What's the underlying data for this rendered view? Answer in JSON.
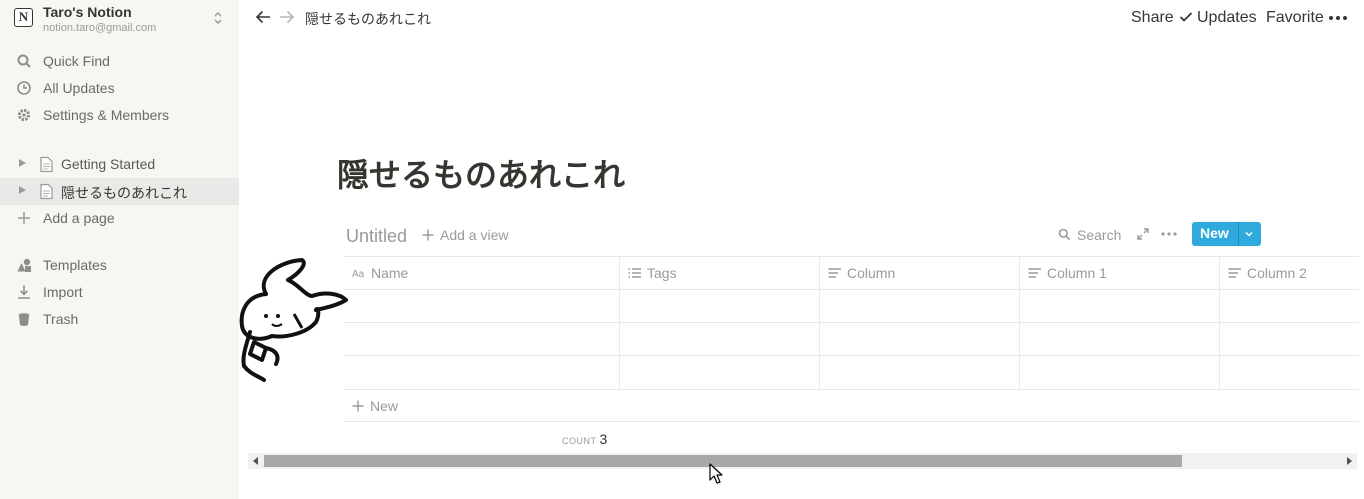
{
  "workspace": {
    "name": "Taro's Notion",
    "email": "notion.taro@gmail.com",
    "logo_letter": "N"
  },
  "sidebar": {
    "top_items": [
      {
        "label": "Quick Find",
        "icon": "search-icon"
      },
      {
        "label": "All Updates",
        "icon": "clock-icon"
      },
      {
        "label": "Settings & Members",
        "icon": "gear-icon"
      }
    ],
    "pages": [
      {
        "label": "Getting Started",
        "icon": "page-icon",
        "active": false
      },
      {
        "label": "隠せるものあれこれ",
        "icon": "page-icon",
        "active": true
      }
    ],
    "add_page": "Add a page",
    "bottom_items": [
      {
        "label": "Templates",
        "icon": "shapes-icon"
      },
      {
        "label": "Import",
        "icon": "download-icon"
      },
      {
        "label": "Trash",
        "icon": "trash-icon"
      }
    ]
  },
  "topbar": {
    "breadcrumb": "隠せるものあれこれ",
    "share": "Share",
    "updates": "Updates",
    "favorite": "Favorite"
  },
  "page": {
    "title": "隠せるものあれこれ"
  },
  "database": {
    "title": "Untitled",
    "add_view": "Add a view",
    "search": "Search",
    "new_button": "New",
    "columns": [
      {
        "label": "Name",
        "icon": "title-icon"
      },
      {
        "label": "Tags",
        "icon": "list-icon"
      },
      {
        "label": "Column",
        "icon": "text-icon"
      },
      {
        "label": "Column 1",
        "icon": "text-icon"
      },
      {
        "label": "Column 2",
        "icon": "text-icon"
      }
    ],
    "rows": [
      [
        "",
        "",
        "",
        "",
        ""
      ],
      [
        "",
        "",
        "",
        "",
        ""
      ],
      [
        "",
        "",
        "",
        "",
        ""
      ]
    ],
    "new_row": "New",
    "count_label": "COUNT",
    "count_value": "3"
  },
  "colors": {
    "accent": "#2eaadc",
    "sidebar_bg": "#f7f6f3",
    "text": "#37352f",
    "muted": "#9b9a97"
  }
}
